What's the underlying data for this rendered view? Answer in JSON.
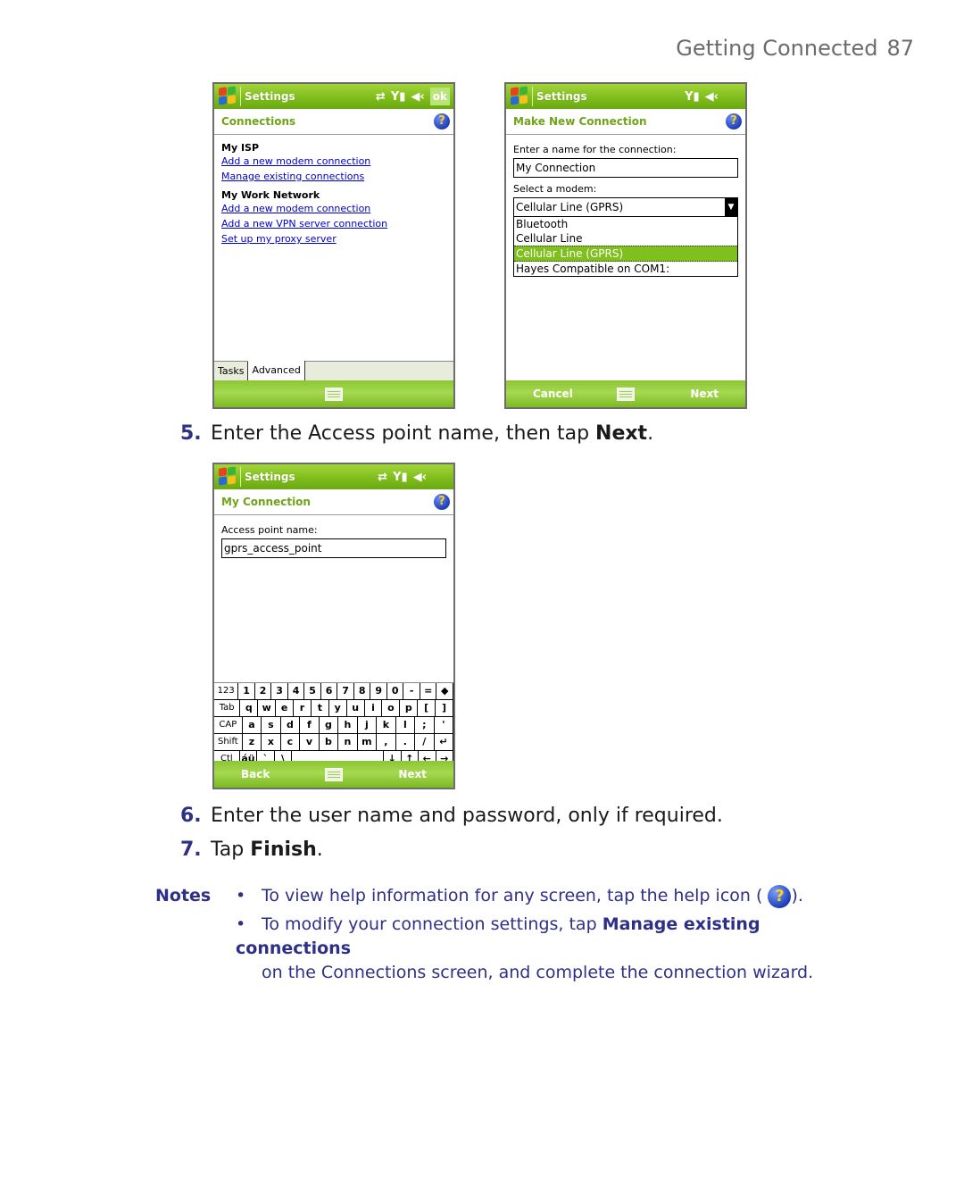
{
  "header": {
    "section": "Getting Connected",
    "page_number": "87"
  },
  "screen_connections": {
    "title": "Settings",
    "ok_label": "ok",
    "subtitle": "Connections",
    "groups": [
      {
        "title": "My ISP",
        "links": [
          "Add a new modem connection",
          "Manage existing connections"
        ]
      },
      {
        "title": "My Work Network",
        "links": [
          "Add a new modem connection",
          "Add a new VPN server connection",
          "Set up my proxy server"
        ]
      }
    ],
    "tabs": [
      "Tasks",
      "Advanced"
    ]
  },
  "screen_make_new": {
    "title": "Settings",
    "subtitle": "Make New Connection",
    "name_label": "Enter a name for the connection:",
    "name_value": "My Connection",
    "modem_label": "Select a modem:",
    "modem_selected": "Cellular Line (GPRS)",
    "modem_options": [
      "Bluetooth",
      "Cellular Line",
      "Cellular Line (GPRS)",
      "Hayes Compatible on COM1:"
    ],
    "cancel_label": "Cancel",
    "next_label": "Next"
  },
  "step5": {
    "number": "5.",
    "text": "Enter the Access point name, then tap ",
    "bold": "Next",
    "end": "."
  },
  "screen_my_connection": {
    "title": "Settings",
    "subtitle": "My Connection",
    "apn_label": "Access point name:",
    "apn_value": "gprs_access_point",
    "keyboard_rows": [
      [
        "123",
        "1",
        "2",
        "3",
        "4",
        "5",
        "6",
        "7",
        "8",
        "9",
        "0",
        "-",
        "=",
        "◆"
      ],
      [
        "Tab",
        "q",
        "w",
        "e",
        "r",
        "t",
        "y",
        "u",
        "i",
        "o",
        "p",
        "[",
        "]"
      ],
      [
        "CAP",
        "a",
        "s",
        "d",
        "f",
        "g",
        "h",
        "j",
        "k",
        "l",
        ";",
        "'"
      ],
      [
        "Shift",
        "z",
        "x",
        "c",
        "v",
        "b",
        "n",
        "m",
        ",",
        ".",
        "/",
        "↵"
      ],
      [
        "Ctl",
        "áü",
        "`",
        "\\",
        " ",
        "↓",
        "↑",
        "←",
        "→"
      ]
    ],
    "back_label": "Back",
    "next_label": "Next"
  },
  "step6": {
    "number": "6.",
    "text": "Enter the user name and password, only if required."
  },
  "step7": {
    "number": "7.",
    "text": "Tap ",
    "bold": "Finish",
    "end": "."
  },
  "notes": {
    "label": "Notes",
    "bullet": "•",
    "note1_pre": "To view help information for any screen, tap the help icon (",
    "note1_post": ").",
    "note2_pre": "To modify your connection settings, tap ",
    "note2_bold": "Manage existing connections",
    "note2_cont": "on the Connections screen, and complete the connection wizard."
  }
}
